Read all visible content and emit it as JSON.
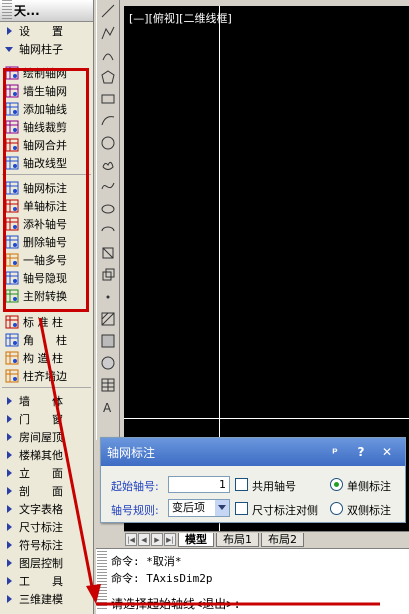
{
  "menu": {
    "title": "天...",
    "items_top": [
      {
        "label": "设　　置",
        "type": "cat"
      },
      {
        "label": "轴网柱子",
        "type": "cat-open"
      }
    ],
    "axis_items": [
      {
        "label": "绘制轴网",
        "icon": "grid-draw-icon"
      },
      {
        "label": "墙生轴网",
        "icon": "wall-axis-icon"
      },
      {
        "label": "添加轴线",
        "icon": "add-axis-icon"
      },
      {
        "label": "轴线裁剪",
        "icon": "axis-trim-icon"
      },
      {
        "label": "轴网合并",
        "icon": "axis-merge-icon"
      },
      {
        "label": "轴改线型",
        "icon": "axis-linetype-icon"
      },
      {
        "label": "轴网标注",
        "icon": "axis-dim-icon"
      },
      {
        "label": "单轴标注",
        "icon": "single-axis-dim-icon"
      },
      {
        "label": "添补轴号",
        "icon": "add-axis-number-icon"
      },
      {
        "label": "删除轴号",
        "icon": "delete-axis-number-icon"
      },
      {
        "label": "一轴多号",
        "icon": "multi-number-icon"
      },
      {
        "label": "轴号隐现",
        "icon": "axis-number-toggle-icon"
      },
      {
        "label": "主附转换",
        "icon": "main-sub-convert-icon"
      }
    ],
    "column_items": [
      {
        "label": "标 准 柱",
        "icon": "standard-column-icon"
      },
      {
        "label": "角　　柱",
        "icon": "corner-column-icon"
      },
      {
        "label": "构 造 柱",
        "icon": "structural-column-icon"
      },
      {
        "label": "柱齐墙边",
        "icon": "column-align-icon"
      }
    ],
    "categories": [
      "墙　　体",
      "门　　窗",
      "房间屋顶",
      "楼梯其他",
      "立　　面",
      "剖　　面",
      "文字表格",
      "尺寸标注",
      "符号标注",
      "图层控制",
      "工　　具",
      "三维建模"
    ]
  },
  "viewport": {
    "label": "[—][俯视][二维线框]"
  },
  "dialog": {
    "title": "轴网标注",
    "pin": "ᵖ",
    "help": "?",
    "close": "✕",
    "start_label": "起始轴号:",
    "start_value": "1",
    "share_label": "共用轴号",
    "single_label": "单侧标注",
    "rule_label": "轴号规则:",
    "rule_value": "变后项",
    "dimpair_label": "尺寸标注对侧",
    "double_label": "双侧标注"
  },
  "tabs": [
    "模型",
    "布局1",
    "布局2"
  ],
  "command": {
    "line1": "命令: *取消*",
    "line2": "命令: TAxisDim2p",
    "prompt": "请选择起始轴线<退出>:"
  },
  "colors": {
    "highlight": "#c80000",
    "dialog_title": "#3d6cc4",
    "label_blue": "#1e3fbf"
  }
}
